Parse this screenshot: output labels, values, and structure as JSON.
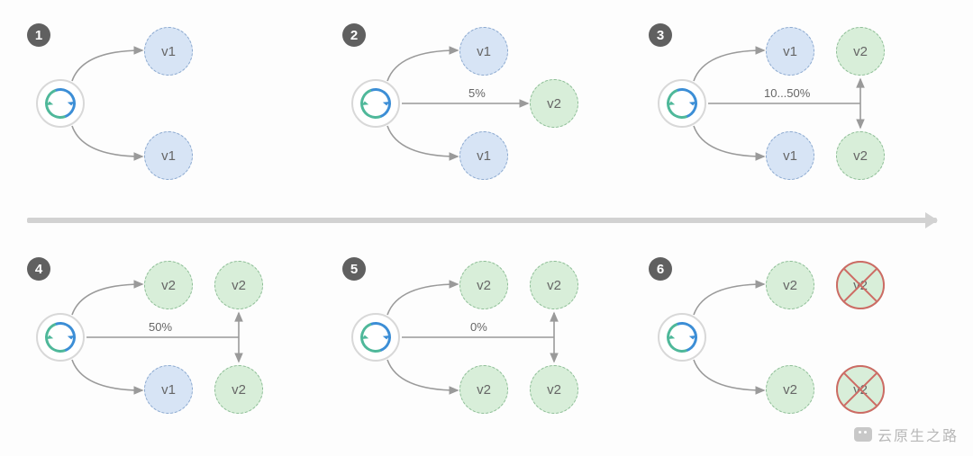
{
  "description": "Canary / progressive rollout diagram showing 6 steps of traffic shifting from v1 to v2, with old v2 extras removed at the end.",
  "timeline": {
    "direction": "left-to-right"
  },
  "versions": {
    "old": "v1",
    "new": "v2"
  },
  "colors": {
    "v1_bg": "#d7e4f5",
    "v2_bg": "#d8eed9",
    "badge": "#606060",
    "arrow": "#9a9a9a",
    "remove": "#cd6b64"
  },
  "watermark": "云原生之路",
  "chart_data": [
    {
      "step": 1,
      "label": "1",
      "canary_traffic_pct_label": "",
      "targets": [
        "v1",
        "v1"
      ],
      "extra": []
    },
    {
      "step": 2,
      "label": "2",
      "canary_traffic_pct_label": "5%",
      "targets": [
        "v1",
        "v2",
        "v1"
      ],
      "extra": []
    },
    {
      "step": 3,
      "label": "3",
      "canary_traffic_pct_label": "10...50%",
      "targets": [
        "v1",
        "v1"
      ],
      "extra": [
        "v2",
        "v2"
      ]
    },
    {
      "step": 4,
      "label": "4",
      "canary_traffic_pct_label": "50%",
      "targets": [
        "v2",
        "v1"
      ],
      "extra": [
        "v2",
        "v2"
      ]
    },
    {
      "step": 5,
      "label": "5",
      "canary_traffic_pct_label": "0%",
      "targets": [
        "v2",
        "v2"
      ],
      "extra": [
        "v2",
        "v2"
      ]
    },
    {
      "step": 6,
      "label": "6",
      "canary_traffic_pct_label": "",
      "targets": [
        "v2",
        "v2"
      ],
      "extra_removed": [
        "v2",
        "v2"
      ]
    }
  ]
}
